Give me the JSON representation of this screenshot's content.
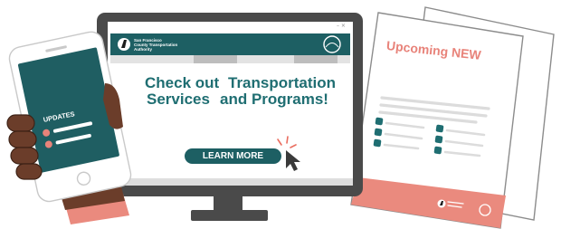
{
  "desktop": {
    "org_line_1": "San Francisco",
    "org_line_2": "County Transportation",
    "org_line_3": "Authority",
    "headline_left_1": "Check out",
    "headline_left_2": "Services",
    "headline_right_1": "Transportation",
    "headline_right_2": "and Programs!",
    "button_label": "LEARN MORE",
    "window_controls": "– ×"
  },
  "phone": {
    "screen_title": "UPDATES"
  },
  "document": {
    "title": "Upcoming NEW"
  },
  "colors": {
    "teal": "#1f6e72",
    "teal_dark": "#1d5f63",
    "salmon": "#e8837a",
    "monitor": "#4a4a4a",
    "skin": "#6b3d2a"
  },
  "icons": [
    "cursor-arrow-icon",
    "click-sparks-icon",
    "logo-mark-icon",
    "one-seal-icon"
  ]
}
